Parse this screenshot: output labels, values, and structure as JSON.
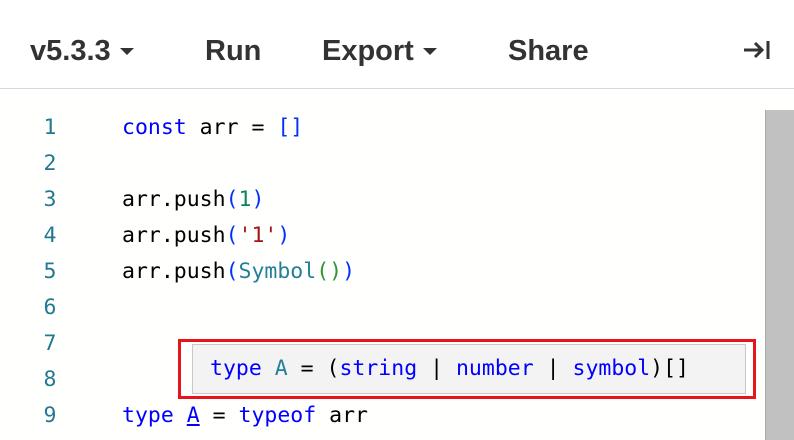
{
  "toolbar": {
    "version_label": "v5.3.3",
    "run_label": "Run",
    "export_label": "Export",
    "share_label": "Share",
    "collapse_icon": "collapse-right-icon"
  },
  "editor": {
    "line_numbers": [
      "1",
      "2",
      "3",
      "4",
      "5",
      "6",
      "7",
      "8",
      "9"
    ],
    "lines": {
      "l1": {
        "kw": "const",
        "rest": " arr = ",
        "bracket": "[]"
      },
      "l3": {
        "obj": "arr.push",
        "open": "(",
        "arg": "1",
        "close": ")"
      },
      "l4": {
        "obj": "arr.push",
        "open": "(",
        "arg": "'1'",
        "close": ")"
      },
      "l5": {
        "obj": "arr.push",
        "open": "(",
        "fn": "Symbol",
        "inner": "()",
        "close": ")"
      },
      "l9": {
        "kw": "type",
        "sp": " ",
        "alias": "A",
        "eq": " = ",
        "op": "typeof",
        "tail": " arr"
      }
    }
  },
  "hover": {
    "kw": "type",
    "name": "A",
    "eq": " = (",
    "t1": "string",
    "sep1": " | ",
    "t2": "number",
    "sep2": " | ",
    "t3": "symbol",
    "tail": ")[]"
  },
  "colors": {
    "keyword": "#0000ff",
    "line_number": "#237893",
    "highlight_border": "#e8141c",
    "hover_bg": "#f3f3f3"
  }
}
